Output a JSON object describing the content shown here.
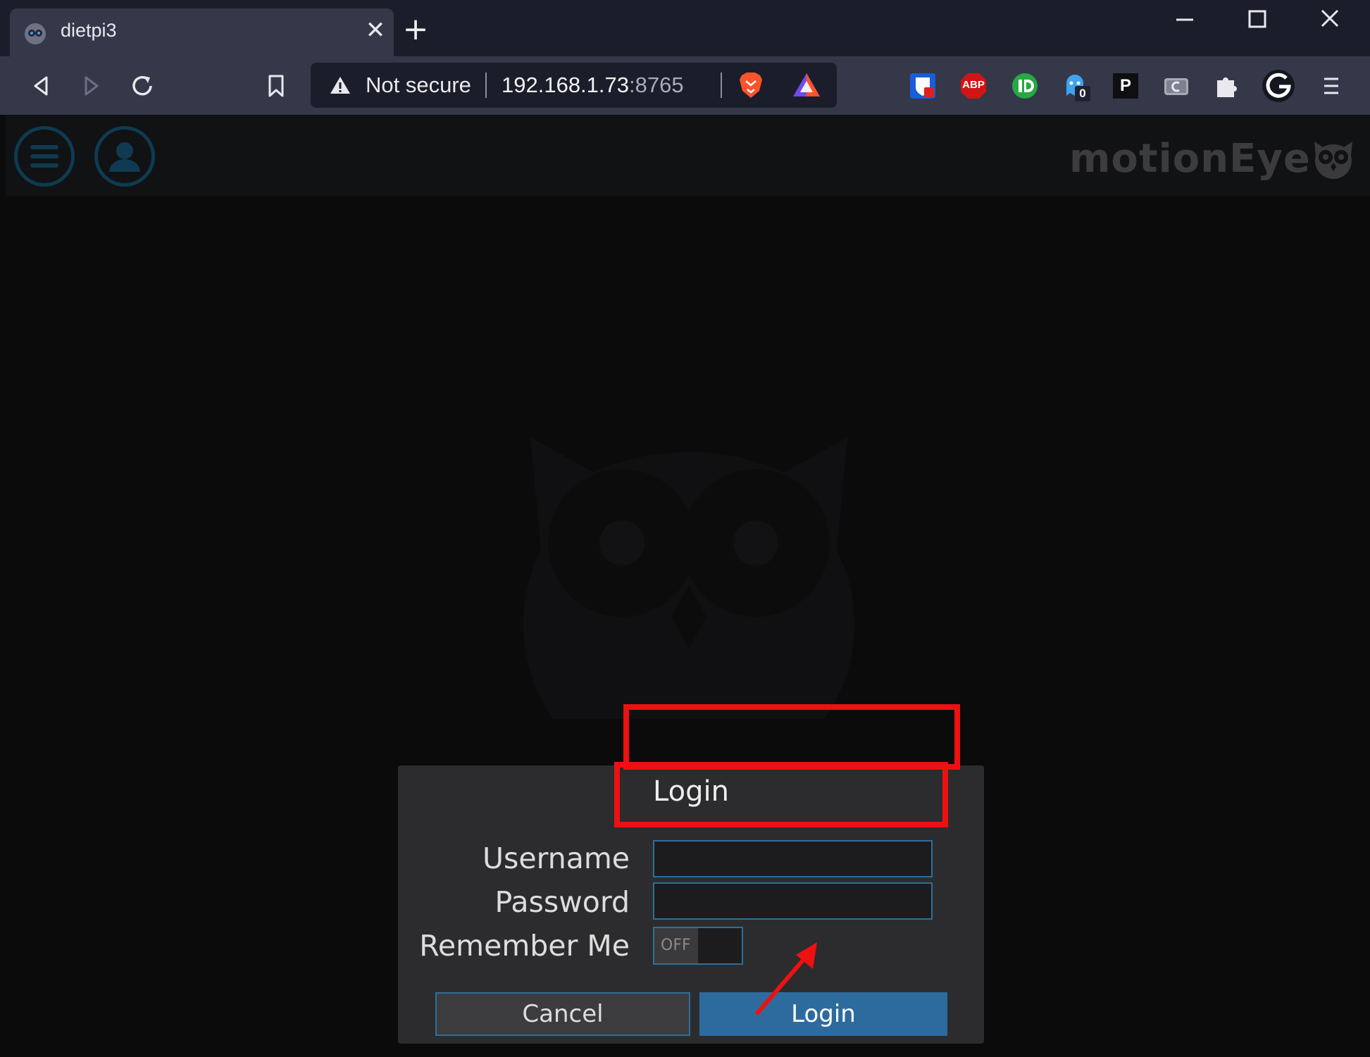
{
  "browser": {
    "tab_title": "dietpi3",
    "tab_close": "✕",
    "new_tab": "+",
    "window": {
      "minimize": "—",
      "maximize": "☐",
      "close": "✕"
    },
    "security_label": "Not secure",
    "url_host": "192.168.1.73",
    "url_port": ":8765",
    "extensions": [
      "bitwarden-icon",
      "adblock-plus-icon",
      "identity-icon",
      "ghostery-icon",
      "pocket-icon",
      "cloud-icon",
      "puzzle-icon",
      "grammarly-icon",
      "menu-icon"
    ],
    "ghostery_badge": "0",
    "abp_label": "ABP",
    "p_label": "P"
  },
  "app": {
    "brand": "motionEye"
  },
  "login_dialog": {
    "title": "Login",
    "username_label": "Username",
    "password_label": "Password",
    "remember_label": "Remember Me",
    "remember_state": "OFF",
    "username_value": "",
    "password_value": "",
    "cancel_label": "Cancel",
    "login_label": "Login"
  },
  "colors": {
    "accent": "#2d6b9f",
    "annotation": "#ee1111",
    "page_bg": "#0b0b0c"
  }
}
